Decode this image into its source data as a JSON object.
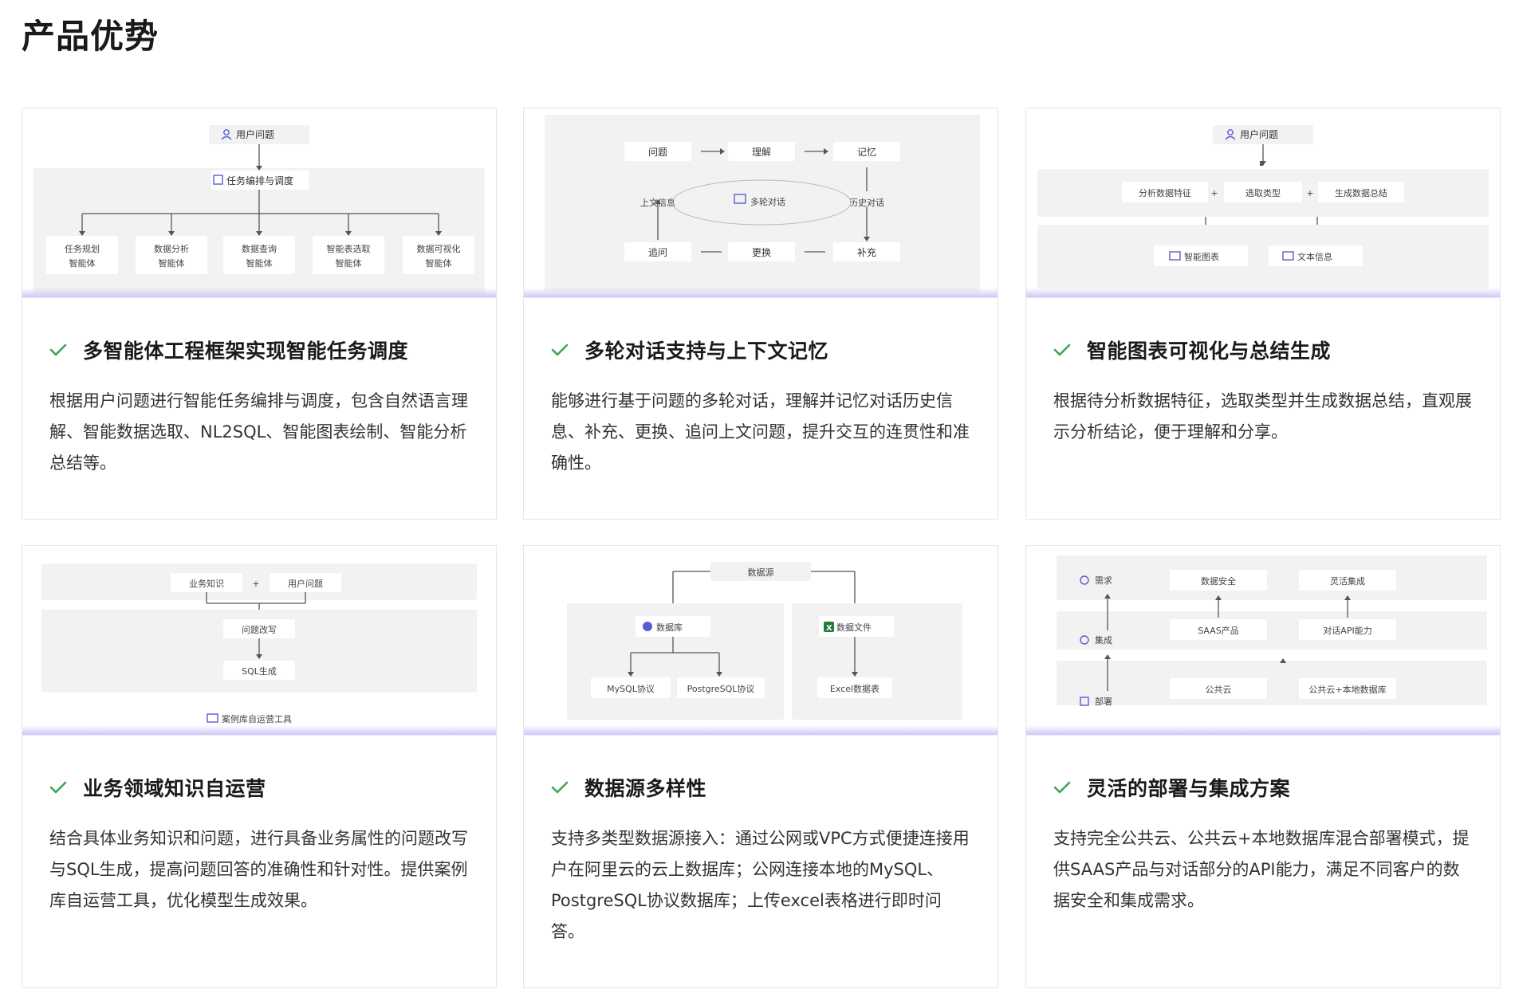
{
  "page_title": "产品优势",
  "colors": {
    "check": "#3aa655",
    "accent_icon": "#5b5bd6",
    "fade": "#c4befa"
  },
  "cards": [
    {
      "title": "多智能体工程框架实现智能任务调度",
      "desc": "根据用户问题进行智能任务编排与调度，包含自然语言理解、智能数据选取、NL2SQL、智能图表绘制、智能分析总结等。",
      "diagram": {
        "top": "用户问题",
        "mid": "任务编排与调度",
        "agents": [
          [
            "任务规划",
            "智能体"
          ],
          [
            "数据分析",
            "智能体"
          ],
          [
            "数据查询",
            "智能体"
          ],
          [
            "智能表选取",
            "智能体"
          ],
          [
            "数据可视化",
            "智能体"
          ]
        ]
      }
    },
    {
      "title": "多轮对话支持与上下文记忆",
      "desc": "能够进行基于问题的多轮对话，理解并记忆对话历史信息、补充、更换、追问上文问题，提升交互的连贯性和准确性。",
      "diagram": {
        "row1": [
          "问题",
          "理解",
          "记忆"
        ],
        "left": "上文信息",
        "center": "多轮对话",
        "right": "历史对话",
        "row3": [
          "追问",
          "更换",
          "补充"
        ]
      }
    },
    {
      "title": "智能图表可视化与总结生成",
      "desc": "根据待分析数据特征，选取类型并生成数据总结，直观展示分析结论，便于理解和分享。",
      "diagram": {
        "top": "用户问题",
        "row": [
          "分析数据特征",
          "选取类型",
          "生成数据总结"
        ],
        "out": [
          "智能图表",
          "文本信息"
        ]
      }
    },
    {
      "title": "业务领域知识自运营",
      "desc": "结合具体业务知识和问题，进行具备业务属性的问题改写与SQL生成，提高问题回答的准确性和针对性。提供案例库自运营工具，优化模型生成效果。",
      "diagram": {
        "top": [
          "业务知识",
          "用户问题"
        ],
        "mid": "问题改写",
        "bottom": "SQL生成",
        "tool": "案例库自运营工具"
      }
    },
    {
      "title": "数据源多样性",
      "desc": "支持多类型数据源接入：通过公网或VPC方式便捷连接用户在阿里云的云上数据库；公网连接本地的MySQL、PostgreSQL协议数据库；上传excel表格进行即时问答。",
      "diagram": {
        "top": "数据源",
        "db": "数据库",
        "file": "数据文件",
        "protocols": [
          "MySQL协议",
          "PostgreSQL协议"
        ],
        "excel": "Excel数据表"
      }
    },
    {
      "title": "灵活的部署与集成方案",
      "desc": "支持完全公共云、公共云+本地数据库混合部署模式，提供SAAS产品与对话部分的API能力，满足不同客户的数据安全和集成需求。",
      "diagram": {
        "side": [
          "需求",
          "集成",
          "部署"
        ],
        "row1": [
          "数据安全",
          "灵活集成"
        ],
        "row2": [
          "SAAS产品",
          "对话API能力"
        ],
        "row3": [
          "公共云",
          "公共云+本地数据库"
        ]
      }
    }
  ]
}
